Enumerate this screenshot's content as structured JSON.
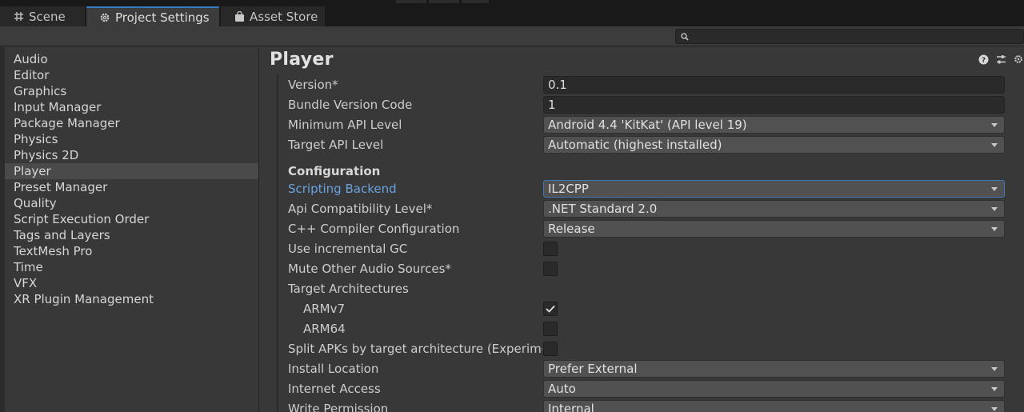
{
  "tabs": [
    {
      "label": "Scene",
      "icon": "grid-icon"
    },
    {
      "label": "Project Settings",
      "icon": "gear-icon"
    },
    {
      "label": "Asset Store",
      "icon": "shopping-bag-icon"
    }
  ],
  "search": {
    "placeholder": "",
    "value": ""
  },
  "sidebar": {
    "items": [
      {
        "label": "Audio"
      },
      {
        "label": "Editor"
      },
      {
        "label": "Graphics"
      },
      {
        "label": "Input Manager"
      },
      {
        "label": "Package Manager"
      },
      {
        "label": "Physics"
      },
      {
        "label": "Physics 2D"
      },
      {
        "label": "Player",
        "selected": true
      },
      {
        "label": "Preset Manager"
      },
      {
        "label": "Quality"
      },
      {
        "label": "Script Execution Order"
      },
      {
        "label": "Tags and Layers"
      },
      {
        "label": "TextMesh Pro"
      },
      {
        "label": "Time"
      },
      {
        "label": "VFX"
      },
      {
        "label": "XR Plugin Management"
      }
    ]
  },
  "main": {
    "title": "Player",
    "rows": {
      "version": {
        "label": "Version*",
        "value": "0.1"
      },
      "bundle_version_code": {
        "label": "Bundle Version Code",
        "value": "1"
      },
      "min_api": {
        "label": "Minimum API Level",
        "value": "Android 4.4 'KitKat' (API level 19)"
      },
      "target_api": {
        "label": "Target API Level",
        "value": "Automatic (highest installed)"
      },
      "configuration": {
        "label": "Configuration"
      },
      "scripting_backend": {
        "label": "Scripting Backend",
        "value": "IL2CPP"
      },
      "api_compat": {
        "label": "Api Compatibility Level*",
        "value": ".NET Standard 2.0"
      },
      "cpp_config": {
        "label": "C++ Compiler Configuration",
        "value": "Release"
      },
      "incremental_gc": {
        "label": "Use incremental GC",
        "checked": false
      },
      "mute_audio": {
        "label": "Mute Other Audio Sources*",
        "checked": false
      },
      "target_arch": {
        "label": "Target Architectures"
      },
      "armv7": {
        "label": "ARMv7",
        "checked": true
      },
      "arm64": {
        "label": "ARM64",
        "checked": false
      },
      "split_apks": {
        "label": "Split APKs by target architecture (Experimental)",
        "checked": false
      },
      "install_location": {
        "label": "Install Location",
        "value": "Prefer External"
      },
      "internet_access": {
        "label": "Internet Access",
        "value": "Auto"
      },
      "write_permission": {
        "label": "Write Permission",
        "value": "Internal"
      }
    }
  },
  "colors": {
    "accent": "#3a79bb",
    "highlight_label": "#6aa1df",
    "background": "#383838"
  }
}
